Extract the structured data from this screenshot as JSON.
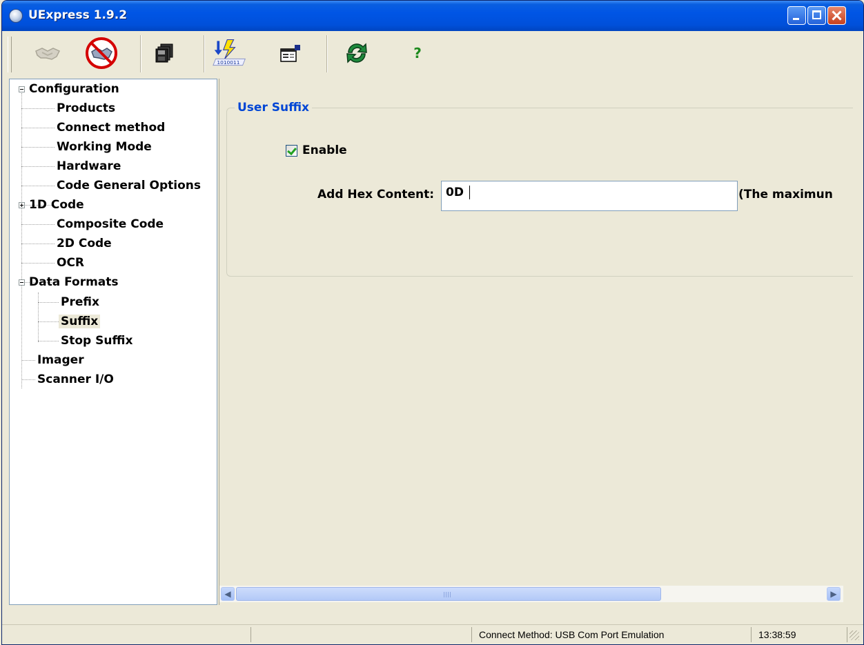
{
  "window": {
    "title": "UExpress 1.9.2"
  },
  "toolbar": {
    "items": [
      {
        "icon": "connect-icon"
      },
      {
        "icon": "disconnect-icon"
      },
      {
        "icon": "save-icon"
      },
      {
        "icon": "download-icon"
      },
      {
        "icon": "properties-icon"
      },
      {
        "icon": "refresh-icon"
      },
      {
        "icon": "help-icon",
        "label": "?"
      }
    ],
    "download_icon_text": "1010011"
  },
  "tree": {
    "configuration": "Configuration",
    "products": "Products",
    "connect_method": "Connect method",
    "working_mode": "Working Mode",
    "hardware": "Hardware",
    "code_general_options": "Code General Options",
    "code_1d": "1D Code",
    "composite_code": "Composite Code",
    "code_2d": "2D Code",
    "ocr": "OCR",
    "data_formats": "Data Formats",
    "prefix": "Prefix",
    "suffix": "Suffix",
    "stop_suffix": "Stop Suffix",
    "imager": "Imager",
    "scanner_io": "Scanner I/O",
    "selected": "Suffix"
  },
  "content": {
    "group_title": "User Suffix",
    "enable_label": "Enable",
    "enable_checked": true,
    "hex_label": "Add Hex Content:",
    "hex_value": "0D",
    "hint": "(The maximun"
  },
  "statusbar": {
    "connect_method": "Connect Method: USB Com Port Emulation",
    "time": "13:38:59"
  },
  "colors": {
    "titlebar": "#0055E5",
    "face": "#ECE9D8",
    "group_title": "#0046D5"
  }
}
